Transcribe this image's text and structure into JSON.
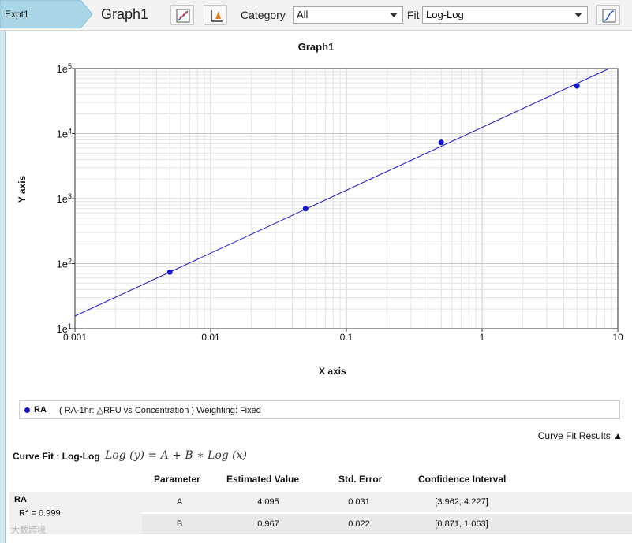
{
  "toolbar": {
    "expt_tab": "Expt1",
    "graph_tab": "Graph1",
    "category_label": "Category",
    "category_value": "All",
    "fit_label": "Fit",
    "fit_value": "Log-Log"
  },
  "chart_data": {
    "type": "scatter",
    "title": "Graph1",
    "xlabel": "X axis",
    "ylabel": "Y axis",
    "x_scale": "log",
    "y_scale": "log",
    "xlim": [
      0.001,
      10
    ],
    "ylim": [
      10,
      100000
    ],
    "grid": true,
    "x_ticks": [
      "0.001",
      "0.01",
      "0.1",
      "1",
      "10"
    ],
    "y_ticks": [
      {
        "base": "1e",
        "exp": "1"
      },
      {
        "base": "1e",
        "exp": "2"
      },
      {
        "base": "1e",
        "exp": "3"
      },
      {
        "base": "1e",
        "exp": "4"
      },
      {
        "base": "1e",
        "exp": "5"
      }
    ],
    "series": [
      {
        "name": "RA",
        "color": "#1515d0",
        "points": [
          {
            "x": 0.005,
            "y": 74
          },
          {
            "x": 0.05,
            "y": 700
          },
          {
            "x": 0.5,
            "y": 7300
          },
          {
            "x": 5,
            "y": 54000
          }
        ],
        "fit": {
          "A": 4.095,
          "B": 0.967
        }
      }
    ]
  },
  "legend": {
    "series_name": "RA",
    "description": "( RA-1hr: △RFU vs Concentration )  Weighting: Fixed"
  },
  "results": {
    "toggle_label": "Curve Fit Results ▲",
    "curve_fit_label": "Curve Fit : Log-Log",
    "equation": "Log (y) = A + B ∗ Log (x)",
    "headers": [
      "Parameter",
      "Estimated Value",
      "Std. Error",
      "Confidence Interval"
    ],
    "row_name": "RA",
    "r2_label": "R",
    "r2_sup": "2",
    "r2_value": " = 0.999",
    "rows": [
      {
        "param": "A",
        "value": "4.095",
        "error": "0.031",
        "ci": "[3.962, 4.227]"
      },
      {
        "param": "B",
        "value": "0.967",
        "error": "0.022",
        "ci": "[0.871, 1.063]"
      }
    ]
  },
  "watermark": "大数跨境"
}
